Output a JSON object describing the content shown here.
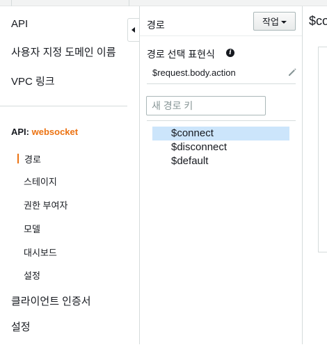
{
  "nav": {
    "top_items": [
      {
        "label": "API"
      },
      {
        "label": "사용자 지정 도메인 이름"
      },
      {
        "label": "VPC 링크"
      }
    ],
    "api_prefix": "API:",
    "api_name": "websocket",
    "sub_items": [
      {
        "label": "경로",
        "active": true
      },
      {
        "label": "스테이지"
      },
      {
        "label": "권한 부여자"
      },
      {
        "label": "모델"
      },
      {
        "label": "대시보드"
      },
      {
        "label": "설정"
      }
    ],
    "bottom_items": [
      {
        "label": "클라이언트 인증서"
      },
      {
        "label": "설정"
      }
    ],
    "accent_color": "#ec7211"
  },
  "routes_panel": {
    "title": "경로",
    "actions_label": "작업",
    "route_selection_label": "경로 선택 표현식",
    "route_selection_value": "$request.body.action",
    "new_key_placeholder": "새 경로 키",
    "routes": [
      {
        "label": "$connect",
        "selected": true
      },
      {
        "label": "$disconnect"
      },
      {
        "label": "$default"
      }
    ],
    "selected_color": "#cce5fb"
  },
  "detail_panel": {
    "title_partial": "$co"
  }
}
